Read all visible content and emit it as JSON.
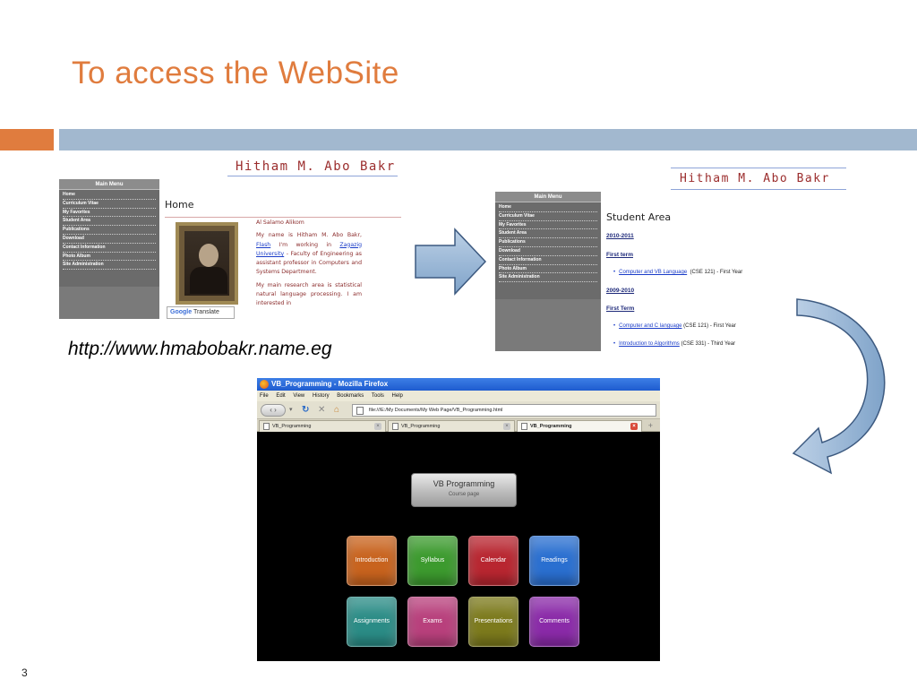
{
  "slide": {
    "title": "To access the WebSite",
    "url": "http://www.hmabobakr.name.eg",
    "page_number": "3",
    "colors": {
      "title": "#e07c3e",
      "accent_bar": "#e07c3e",
      "band": "#a2b8cf"
    }
  },
  "site_header": "Hitham M. Abo Bakr",
  "main_menu": {
    "title": "Main Menu",
    "items": [
      "Home",
      "Curriculum Vitae",
      "My Favorites",
      "Student Area",
      "Publications",
      "Download",
      "Contact Information",
      "Photo Album",
      "Site Administration"
    ]
  },
  "home_page": {
    "heading": "Home",
    "greeting": "Al Salamo Alikom",
    "bio_part1": "My name is Hitham M. Abo Bakr,",
    "flash_link": "Flash",
    "bio_part2": "I'm working in",
    "university_link": "Zagazig University",
    "bio_part3": "- Faculty of Engineering as assistant professor in Computers and Systems Department.",
    "bio_part4": "My main research area is statistical natural language processing. I am interested in",
    "translate_brand": "Google",
    "translate_label": "Translate"
  },
  "student_area": {
    "title": "Student Area",
    "years": [
      {
        "year": "2010-2011",
        "term": "First term",
        "courses": [
          {
            "name": "Computer and VB Language",
            "detail": "(CSE 121) - First Year"
          }
        ]
      },
      {
        "year": "2009-2010",
        "term": "First Term",
        "courses": [
          {
            "name": "Computer and C language",
            "detail": "(CSE 121) - First Year"
          },
          {
            "name": "Introduction to Algorithms",
            "detail": "(CSE 331) - Third Year"
          }
        ]
      }
    ]
  },
  "firefox": {
    "window_title": "VB_Programming - Mozilla Firefox",
    "menu": [
      "File",
      "Edit",
      "View",
      "History",
      "Bookmarks",
      "Tools",
      "Help"
    ],
    "address": "file:///E:/My Documents/My Web Page/VB_Programming.html",
    "tabs": [
      "VB_Programming",
      "VB_Programming",
      "VB_Programming"
    ],
    "active_tab_index": 2,
    "page": {
      "title": "VB Programming",
      "subtitle": "Course page",
      "buttons_row1": [
        {
          "label": "Introduction",
          "color": "#c8631e"
        },
        {
          "label": "Syllabus",
          "color": "#3c9a2e"
        },
        {
          "label": "Calendar",
          "color": "#b82630"
        },
        {
          "label": "Readings",
          "color": "#2a6fd0"
        }
      ],
      "buttons_row2": [
        {
          "label": "Assignments",
          "color": "#2b8c86"
        },
        {
          "label": "Exams",
          "color": "#b8407c"
        },
        {
          "label": "Presentations",
          "color": "#7c7a1c"
        },
        {
          "label": "Comments",
          "color": "#8a2aa8"
        }
      ]
    }
  }
}
